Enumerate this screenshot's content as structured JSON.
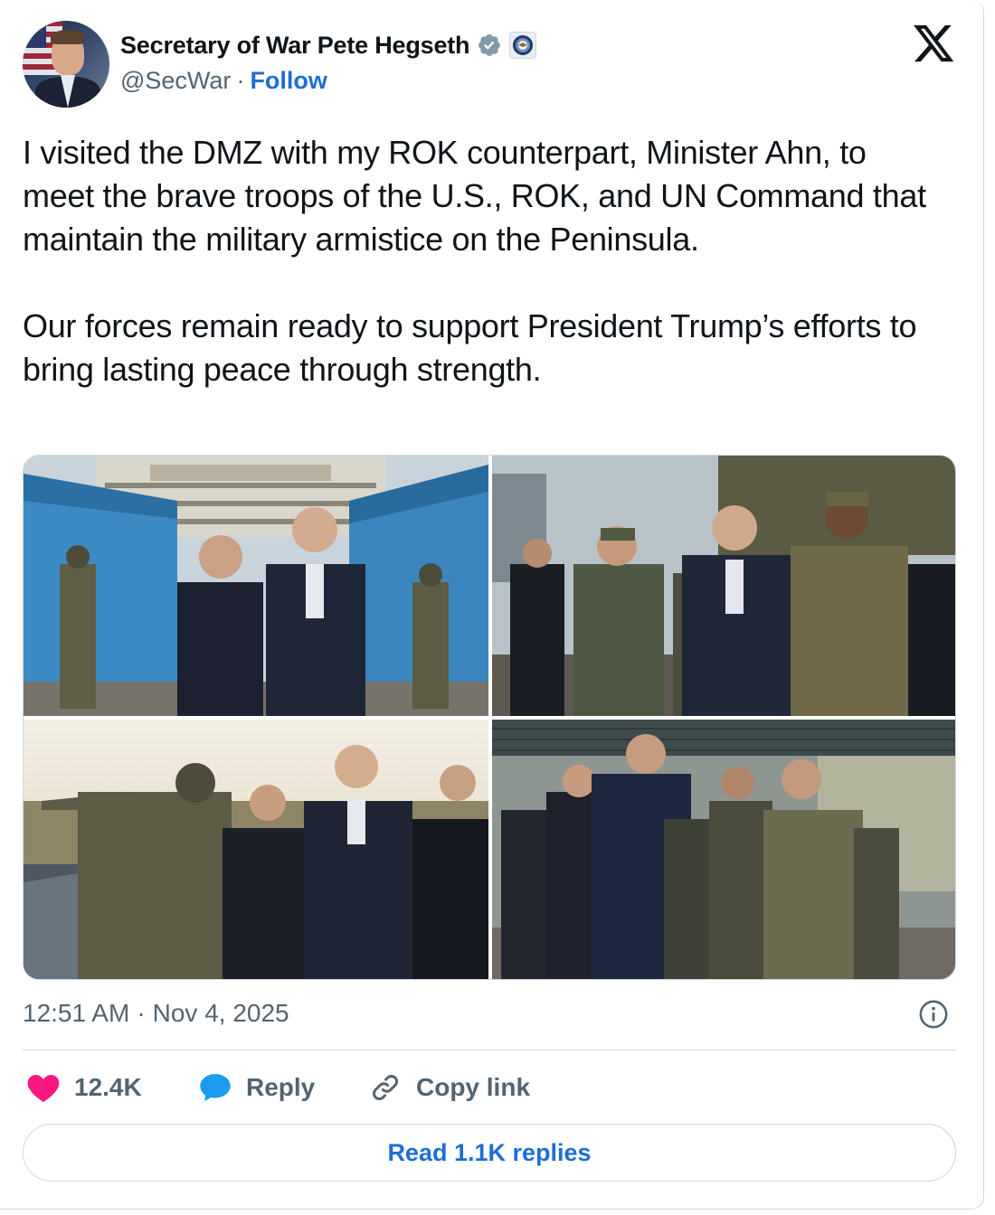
{
  "author": {
    "display_name": "Secretary of War Pete Hegseth",
    "handle": "@SecWar",
    "separator": "·",
    "follow_label": "Follow"
  },
  "tweet": {
    "text": "I visited the DMZ with my ROK counterpart, Minister Ahn, to meet the brave troops of the U.S., ROK, and UN Command that maintain the military armistice on the Peninsula.\n\nOur forces remain ready to support President Trump’s efforts to bring lasting peace through strength.",
    "time": "12:51 AM",
    "date_separator": "·",
    "date": "Nov 4, 2025"
  },
  "photos": [
    {
      "name": "photo-handshake-jsa"
    },
    {
      "name": "photo-walking-with-officers"
    },
    {
      "name": "photo-overlook-pointing"
    },
    {
      "name": "photo-troops-lineup"
    }
  ],
  "actions": {
    "like_count": "12.4K",
    "reply_label": "Reply",
    "copy_link_label": "Copy link"
  },
  "read_replies_label": "Read 1.1K replies",
  "icons": {
    "verified": "verified-badge-icon",
    "affiliation": "dod-seal-icon",
    "x_logo": "x-logo-icon",
    "info": "info-icon",
    "like": "heart-icon",
    "reply": "speech-bubble-icon",
    "copy_link": "link-icon"
  },
  "colors": {
    "link_blue": "#1d6ed6",
    "verified_gray": "#829aab",
    "heart_pink": "#f91880",
    "reply_blue": "#1d9bf0",
    "muted_text": "#536471",
    "border": "#cfd9de"
  }
}
